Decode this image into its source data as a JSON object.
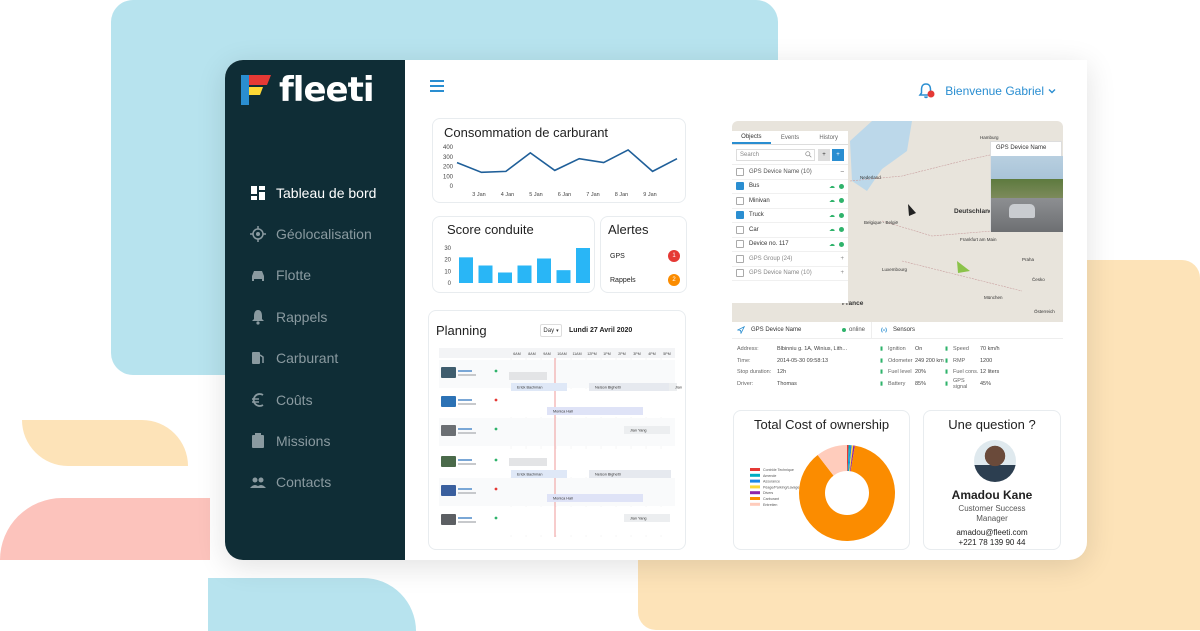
{
  "brand": {
    "name": "fleeti"
  },
  "sidebar": {
    "items": [
      {
        "label": "Tableau de bord",
        "icon": "dashboard-icon",
        "active": true
      },
      {
        "label": "Géolocalisation",
        "icon": "location-icon"
      },
      {
        "label": "Flotte",
        "icon": "car-icon"
      },
      {
        "label": "Rappels",
        "icon": "bell-icon"
      },
      {
        "label": "Carburant",
        "icon": "fuel-icon"
      },
      {
        "label": "Coûts",
        "icon": "euro-icon"
      },
      {
        "label": "Missions",
        "icon": "clipboard-icon"
      },
      {
        "label": "Contacts",
        "icon": "people-icon"
      }
    ]
  },
  "header": {
    "welcome": "Bienvenue Gabriel"
  },
  "fuel": {
    "title": "Consommation de carburant",
    "chart_data": {
      "type": "line",
      "x": [
        "3 Jan",
        "4 Jan",
        "5 Jan",
        "6 Jan",
        "7 Jan",
        "8 Jan",
        "9 Jan"
      ],
      "y": [
        240,
        140,
        150,
        340,
        160,
        280,
        240,
        370,
        150,
        280
      ],
      "ylim": [
        0,
        400
      ],
      "yticks": [
        "400",
        "300",
        "200",
        "100",
        "0"
      ]
    }
  },
  "score": {
    "title": "Score conduite",
    "chart_data": {
      "type": "bar",
      "values": [
        22,
        15,
        9,
        15,
        21,
        11,
        30
      ],
      "ylim": [
        0,
        30
      ],
      "yticks": [
        "30",
        "20",
        "10",
        "0"
      ]
    }
  },
  "alerts": {
    "title": "Alertes",
    "items": [
      {
        "label": "GPS",
        "count": "1",
        "color": "#e53935"
      },
      {
        "label": "Rappels",
        "count": "2",
        "color": "#fb8c00"
      }
    ]
  },
  "planning": {
    "title": "Planning",
    "view": "Day",
    "date": "Lundi 27 Avril 2020",
    "hours": [
      "6AM",
      "8AM",
      "9AM",
      "10AM",
      "11AM",
      "12PM",
      "1PM",
      "2PM",
      "3PM",
      "4PM",
      "5PM"
    ],
    "bookings": [
      "Erick Bachman",
      "Nelson Bighetti",
      "Monica Hall",
      "Jian Yang",
      "Jian"
    ]
  },
  "map": {
    "tabs": [
      "Objects",
      "Events",
      "History"
    ],
    "search_placeholder": "Search",
    "group": "GPS Device Name (10)",
    "devices": [
      {
        "name": "Bus",
        "checked": true
      },
      {
        "name": "Minivan",
        "checked": false
      },
      {
        "name": "Truck",
        "checked": true
      },
      {
        "name": "Car",
        "checked": false
      },
      {
        "name": "Device no. 117",
        "checked": false
      }
    ],
    "groups": [
      "GPS Group (24)",
      "GPS Device Name (10)"
    ],
    "popup": "GPS Device Name",
    "cities": [
      "Hamburg",
      "Berlin",
      "Nederland",
      "Belgique - België",
      "Deutschland",
      "Luxembourg",
      "Frankfurt am Main",
      "Praha",
      "Česko",
      "München",
      "France",
      "Österreich"
    ]
  },
  "device": {
    "name": "GPS Device Name",
    "status": "online",
    "sensors_label": "Sensors",
    "info": [
      {
        "k": "Address:",
        "v": "Blbinniu g. 1A, Winius, Lith..."
      },
      {
        "k": "Time:",
        "v": "2014-05-30 09:58:13"
      },
      {
        "k": "Stop duration:",
        "v": "12h"
      },
      {
        "k": "Driver:",
        "v": "Thomas"
      }
    ],
    "sensors": [
      {
        "k": "Ignition",
        "v": "On",
        "k2": "Speed",
        "v2": "70 km/h"
      },
      {
        "k": "Odometer",
        "v": "249 200 km",
        "k2": "RMP",
        "v2": "1200"
      },
      {
        "k": "Fuel level",
        "v": "20%",
        "k2": "Fuel cons.",
        "v2": "12 liters"
      },
      {
        "k": "Battery",
        "v": "85%",
        "k2": "GPS signal",
        "v2": "45%"
      }
    ]
  },
  "tco": {
    "title": "Total Cost of ownership",
    "chart_data": {
      "type": "pie",
      "labels": [
        "Contrôle Technique",
        "Amende",
        "Assurance",
        "Péage/Parking/Lavage",
        "Divers",
        "Carburant",
        "Entretien"
      ],
      "values": [
        0.5,
        0.5,
        0.5,
        0.5,
        0.5,
        83,
        10
      ],
      "colors": [
        "#e53935",
        "#00acc1",
        "#1e88e5",
        "#fdd835",
        "#8e24aa",
        "#fb8c00",
        "#ffccbc"
      ]
    }
  },
  "contact": {
    "title": "Une question ?",
    "name": "Amadou Kane",
    "role_line1": "Customer Success",
    "role_line2": "Manager",
    "email": "amadou@fleeti.com",
    "phone": "+221 78 139 90 44"
  }
}
